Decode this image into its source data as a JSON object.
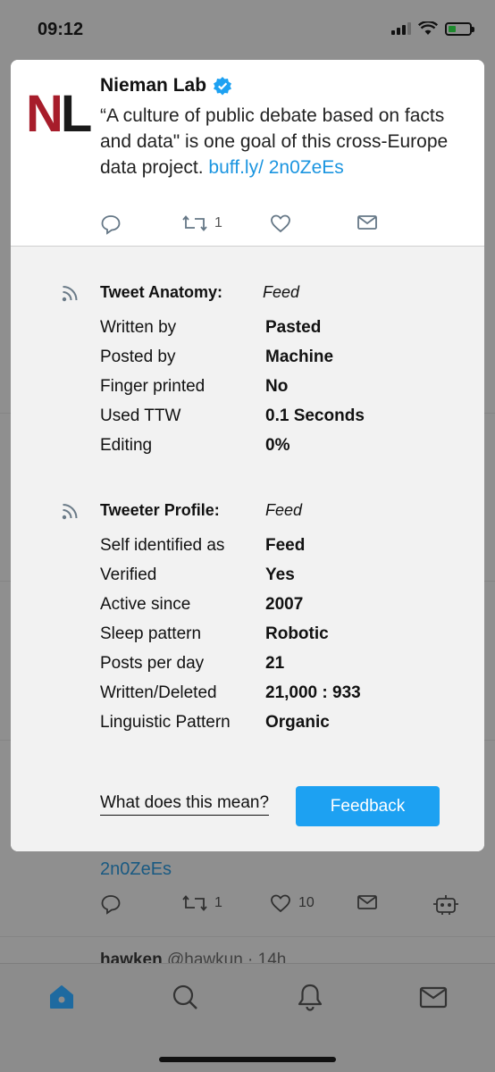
{
  "status_bar": {
    "time": "09:12"
  },
  "tweet": {
    "author": "Nieman Lab",
    "logo_text_1": "N",
    "logo_text_2": "L",
    "text": "“A culture of public debate based on facts and data\" is one goal of this cross-Europe data project.",
    "link": "buff.ly/ 2n0ZeEs",
    "retweet_count": "1"
  },
  "anatomy": {
    "title": "Tweet Anatomy:",
    "value": "Feed",
    "rows": [
      {
        "label": "Written by",
        "value": "Pasted"
      },
      {
        "label": "Posted by",
        "value": "Machine"
      },
      {
        "label": "Finger printed",
        "value": "No"
      },
      {
        "label": "Used TTW",
        "value": "0.1 Seconds"
      },
      {
        "label": "Editing",
        "value": "0%"
      }
    ]
  },
  "profile": {
    "title": "Tweeter Profile:",
    "value": "Feed",
    "rows": [
      {
        "label": "Self identified as",
        "value": "Feed"
      },
      {
        "label": "Verified",
        "value": "Yes"
      },
      {
        "label": "Active since",
        "value": "2007"
      },
      {
        "label": "Sleep pattern",
        "value": "Robotic"
      },
      {
        "label": "Posts per day",
        "value": "21"
      },
      {
        "label": "Written/Deleted",
        "value": "21,000 : 933"
      },
      {
        "label": "Linguistic Pattern",
        "value": "Organic"
      }
    ]
  },
  "footer": {
    "what_link": "What does this mean?",
    "feedback_label": "Feedback"
  },
  "background": {
    "link_fragment": "2n0ZeEs",
    "retweet_count": "1",
    "like_count": "10",
    "next_user": "hawken",
    "next_handle": "@hawkun · 14h"
  },
  "colors": {
    "accent": "#1da1f2",
    "brand_red": "#a71d2b"
  }
}
